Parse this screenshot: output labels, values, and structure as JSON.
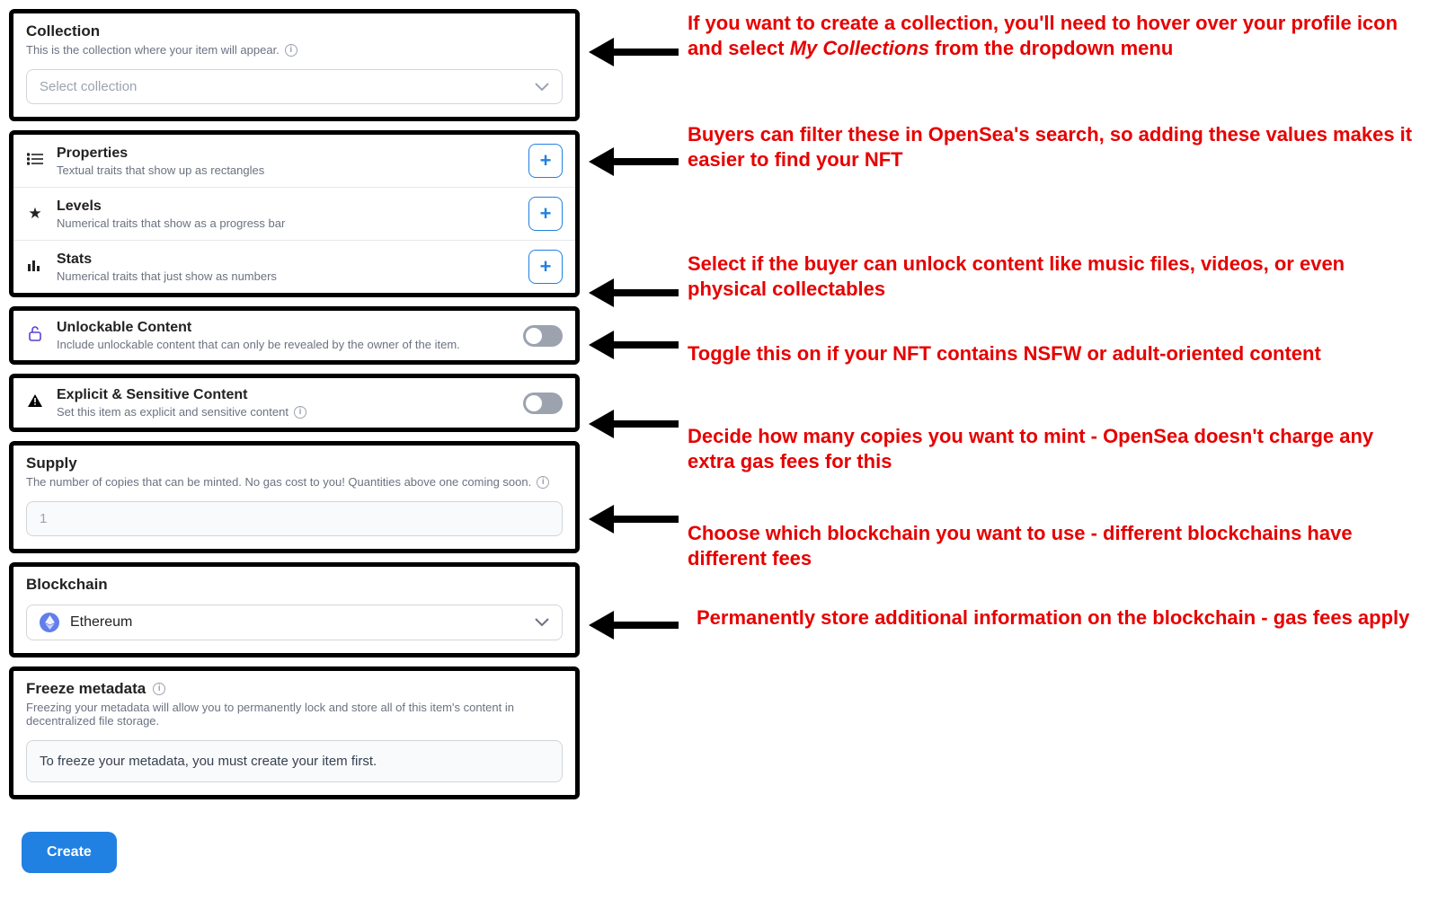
{
  "form": {
    "collection": {
      "title": "Collection",
      "sub": "This is the collection where your item will appear.",
      "placeholder": "Select collection"
    },
    "traits": [
      {
        "icon": "list",
        "title": "Properties",
        "sub": "Textual traits that show up as rectangles"
      },
      {
        "icon": "star",
        "title": "Levels",
        "sub": "Numerical traits that show as a progress bar"
      },
      {
        "icon": "bars",
        "title": "Stats",
        "sub": "Numerical traits that just show as numbers"
      }
    ],
    "unlockable": {
      "title": "Unlockable Content",
      "sub": "Include unlockable content that can only be revealed by the owner of the item."
    },
    "explicit": {
      "title": "Explicit & Sensitive Content",
      "sub": "Set this item as explicit and sensitive content"
    },
    "supply": {
      "title": "Supply",
      "sub": "The number of copies that can be minted. No gas cost to you! Quantities above one coming soon.",
      "value": "1"
    },
    "blockchain": {
      "title": "Blockchain",
      "selected": "Ethereum"
    },
    "freeze": {
      "title": "Freeze metadata",
      "sub": "Freezing your metadata will allow you to permanently lock and store all of this item's content in decentralized file storage.",
      "box": "To freeze your metadata, you must create your item first."
    },
    "create_label": "Create"
  },
  "notes": {
    "n1_a": "If you want to create a collection, you'll need to hover over your profile icon and select ",
    "n1_b": "My Collections",
    "n1_c": " from the dropdown menu",
    "n2": "Buyers can filter these in OpenSea's search, so adding these values makes it easier to find your NFT",
    "n3": "Select if the buyer can unlock content like music files, videos, or even physical collectables",
    "n4": "Toggle this on if your NFT contains NSFW or adult-oriented content",
    "n5": "Decide how many copies you want to mint - OpenSea doesn't charge any extra gas fees for this",
    "n6": "Choose which blockchain you want to use - different blockchains have different fees",
    "n7": "Permanently store additional information on the blockchain - gas fees apply"
  },
  "plus": "+",
  "info": "i"
}
